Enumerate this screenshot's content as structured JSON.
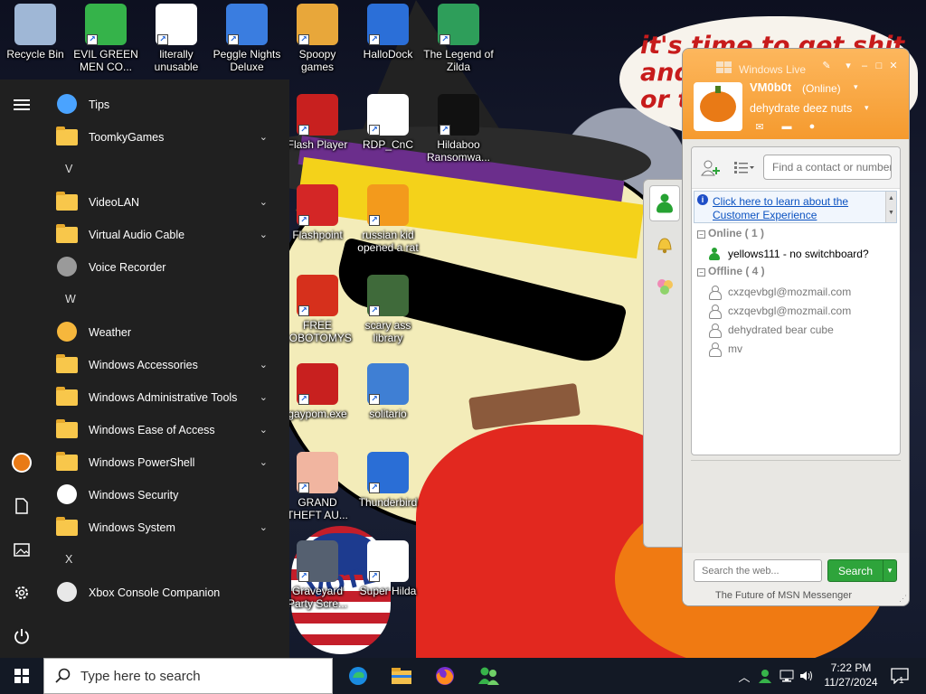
{
  "wallpaper": {
    "speech_text": "it's time to get shit\nand\nor t",
    "sign_text": "VOTE"
  },
  "desktop_icons": [
    {
      "label": "Recycle Bin",
      "icon": "recycle-bin-icon",
      "color": "#9fb7d6"
    },
    {
      "label": "EVIL GREEN MEN CO...",
      "icon": "msn-buddies-icon",
      "color": "#35b34a"
    },
    {
      "label": "literally unusable",
      "icon": "chrome-icon",
      "color": "#ffffff"
    },
    {
      "label": "Peggle Nights Deluxe",
      "icon": "peggle-icon",
      "color": "#3a7de0"
    },
    {
      "label": "Spoopy games",
      "icon": "folder-games-icon",
      "color": "#e8a73a"
    },
    {
      "label": "HalloDock",
      "icon": "shield-icon",
      "color": "#2b6fd8"
    },
    {
      "label": "The Legend of Zilda",
      "icon": "zilda-icon",
      "color": "#2e9e5a"
    },
    {
      "label": "Flash Player",
      "icon": "flash-icon",
      "color": "#c8201f"
    },
    {
      "label": "RDP_CnC",
      "icon": "rdp-icon",
      "color": "#ffffff"
    },
    {
      "label": "Hildaboo Ransomwa...",
      "icon": "yashma-icon",
      "color": "#111111"
    },
    {
      "label": "Flashpoint",
      "icon": "flashpoint-icon",
      "color": "#d42626"
    },
    {
      "label": "russian kid opened a rat",
      "icon": "de-icon",
      "color": "#f39a1c"
    },
    {
      "label": "FREE LOBOTOMYS",
      "icon": "lobotomy-icon",
      "color": "#d6301c"
    },
    {
      "label": "scary ass library",
      "icon": "library-icon",
      "color": "#3f6a3a"
    },
    {
      "label": "gaypom.exe",
      "icon": "flash-exe-icon",
      "color": "#c8201f"
    },
    {
      "label": "solitario",
      "icon": "solitaire-icon",
      "color": "#3f7fd4"
    },
    {
      "label": "GRAND THEFT AU...",
      "icon": "gta-icon",
      "color": "#f1b5a0"
    },
    {
      "label": "Thunderbird",
      "icon": "thunderbird-icon",
      "color": "#2a6ed6"
    },
    {
      "label": "Graveyard Party Scre...",
      "icon": "graveyard-icon",
      "color": "#556070"
    },
    {
      "label": "Super Hilda",
      "icon": "super-hilda-icon",
      "color": "#ffffff"
    }
  ],
  "start_menu": {
    "rail": [
      "hamburger-icon",
      "user-avatar-icon",
      "documents-icon",
      "pictures-icon",
      "settings-icon",
      "power-icon"
    ],
    "items": [
      {
        "type": "app",
        "label": "Tips",
        "icon": "lightbulb-icon",
        "expandable": false
      },
      {
        "type": "folder",
        "label": "ToomkyGames",
        "expandable": true
      },
      {
        "type": "letter",
        "label": "V"
      },
      {
        "type": "folder",
        "label": "VideoLAN",
        "expandable": true
      },
      {
        "type": "folder",
        "label": "Virtual Audio Cable",
        "expandable": true
      },
      {
        "type": "app",
        "label": "Voice Recorder",
        "icon": "microphone-icon",
        "expandable": false
      },
      {
        "type": "letter",
        "label": "W"
      },
      {
        "type": "app",
        "label": "Weather",
        "icon": "weather-icon",
        "expandable": false
      },
      {
        "type": "folder",
        "label": "Windows Accessories",
        "expandable": true
      },
      {
        "type": "folder",
        "label": "Windows Administrative Tools",
        "expandable": true
      },
      {
        "type": "folder",
        "label": "Windows Ease of Access",
        "expandable": true
      },
      {
        "type": "folder",
        "label": "Windows PowerShell",
        "expandable": true
      },
      {
        "type": "app",
        "label": "Windows Security",
        "icon": "shield-icon",
        "expandable": false
      },
      {
        "type": "folder",
        "label": "Windows System",
        "expandable": true
      },
      {
        "type": "letter",
        "label": "X"
      },
      {
        "type": "app",
        "label": "Xbox Console Companion",
        "icon": "xbox-icon",
        "expandable": false
      }
    ]
  },
  "msn": {
    "title": "Windows Live",
    "username": "VM0b0t",
    "status": "(Online)",
    "personal_message": "dehydrate deez nuts",
    "find_placeholder": "Find a contact or number",
    "ad_text": "Click here to learn about the Customer Experience",
    "groups": [
      {
        "label": "Online ( 1 )",
        "contacts": [
          {
            "name": "yellows111 - no switchboard?",
            "online": true
          }
        ]
      },
      {
        "label": "Offline ( 4 )",
        "contacts": [
          {
            "name": "cxzqevbgl@mozmail.com",
            "online": false
          },
          {
            "name": "cxzqevbgl@mozmail.com",
            "online": false
          },
          {
            "name": "dehydrated bear cube",
            "online": false
          },
          {
            "name": "mv",
            "online": false
          }
        ]
      }
    ],
    "web_search_placeholder": "Search the web...",
    "search_label": "Search",
    "footer": "The Future of MSN Messenger"
  },
  "taskbar": {
    "search_placeholder": "Type here to search",
    "apps": [
      "edge-icon",
      "file-explorer-icon",
      "firefox-icon",
      "msn-messenger-icon"
    ],
    "clock_time": "7:22 PM",
    "clock_date": "11/27/2024",
    "notification_count": "1"
  }
}
